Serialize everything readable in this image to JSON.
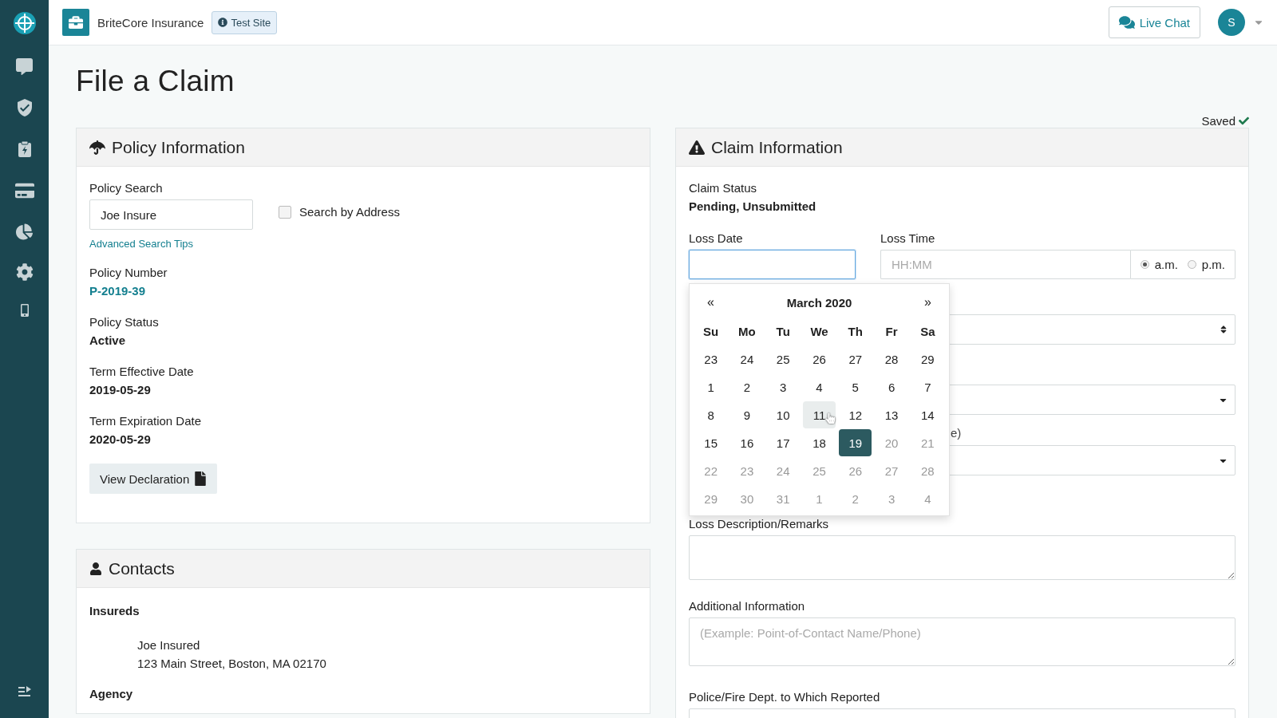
{
  "app": {
    "brand": "BriteCore Insurance",
    "badge": "Test Site",
    "live_chat": "Live Chat",
    "avatar": "S"
  },
  "page": {
    "title": "File a Claim",
    "save_status": "Saved"
  },
  "policy": {
    "title": "Policy Information",
    "search_label": "Policy Search",
    "search_value": "Joe Insure",
    "search_by_address": {
      "label": "Search by Address",
      "checked": false
    },
    "tips_link": "Advanced Search Tips",
    "fields": [
      {
        "label": "Policy Number",
        "value": "P-2019-39",
        "kind": "link"
      },
      {
        "label": "Policy Status",
        "value": "Active",
        "kind": "text"
      },
      {
        "label": "Term Effective Date",
        "value": "2019-05-29",
        "kind": "text"
      },
      {
        "label": "Term Expiration Date",
        "value": "2020-05-29",
        "kind": "text"
      }
    ],
    "button": "View Declaration"
  },
  "contacts": {
    "title": "Contacts",
    "groups": [
      {
        "title": "Insureds",
        "name": "Joe Insured",
        "address": "123 Main Street, Boston, MA 02170"
      }
    ],
    "next_heading": "Agency"
  },
  "claim": {
    "title": "Claim Information",
    "status_label": "Claim Status",
    "status_value": "Pending, Unsubmitted",
    "loss_date": {
      "label": "Loss Date",
      "focused": true
    },
    "loss_time": {
      "label": "Loss Time",
      "placeholder": "HH:MM",
      "meridiem": [
        {
          "label": "a.m.",
          "selected": true
        },
        {
          "label": "p.m.",
          "selected": false
        }
      ]
    },
    "covered_fields": [
      {
        "kind": "spinner"
      },
      {
        "kind": "dropdown"
      },
      {
        "kind": "dropdown",
        "label_tail": "e)"
      }
    ],
    "loss_description": {
      "label": "Loss Description/Remarks"
    },
    "additional": {
      "label": "Additional Information",
      "placeholder": "(Example: Point-of-Contact Name/Phone)"
    },
    "police": {
      "label": "Police/Fire Dept. to Which Reported"
    }
  },
  "calendar": {
    "month": "March 2020",
    "prev": "«",
    "next": "»",
    "weekdays": [
      "Su",
      "Mo",
      "Tu",
      "We",
      "Th",
      "Fr",
      "Sa"
    ],
    "weeks": [
      [
        {
          "label": "23",
          "faded": false,
          "hovered": false,
          "selected": false
        },
        {
          "label": "24",
          "faded": false,
          "hovered": false,
          "selected": false
        },
        {
          "label": "25",
          "faded": false,
          "hovered": false,
          "selected": false
        },
        {
          "label": "26",
          "faded": false,
          "hovered": false,
          "selected": false
        },
        {
          "label": "27",
          "faded": false,
          "hovered": false,
          "selected": false
        },
        {
          "label": "28",
          "faded": false,
          "hovered": false,
          "selected": false
        },
        {
          "label": "29",
          "faded": false,
          "hovered": false,
          "selected": false
        }
      ],
      [
        {
          "label": "1",
          "faded": false,
          "hovered": false,
          "selected": false
        },
        {
          "label": "2",
          "faded": false,
          "hovered": false,
          "selected": false
        },
        {
          "label": "3",
          "faded": false,
          "hovered": false,
          "selected": false
        },
        {
          "label": "4",
          "faded": false,
          "hovered": false,
          "selected": false
        },
        {
          "label": "5",
          "faded": false,
          "hovered": false,
          "selected": false
        },
        {
          "label": "6",
          "faded": false,
          "hovered": false,
          "selected": false
        },
        {
          "label": "7",
          "faded": false,
          "hovered": false,
          "selected": false
        }
      ],
      [
        {
          "label": "8",
          "faded": false,
          "hovered": false,
          "selected": false
        },
        {
          "label": "9",
          "faded": false,
          "hovered": false,
          "selected": false
        },
        {
          "label": "10",
          "faded": false,
          "hovered": false,
          "selected": false
        },
        {
          "label": "11",
          "faded": false,
          "hovered": true,
          "selected": false
        },
        {
          "label": "12",
          "faded": false,
          "hovered": false,
          "selected": false
        },
        {
          "label": "13",
          "faded": false,
          "hovered": false,
          "selected": false
        },
        {
          "label": "14",
          "faded": false,
          "hovered": false,
          "selected": false
        }
      ],
      [
        {
          "label": "15",
          "faded": false,
          "hovered": false,
          "selected": false
        },
        {
          "label": "16",
          "faded": false,
          "hovered": false,
          "selected": false
        },
        {
          "label": "17",
          "faded": false,
          "hovered": false,
          "selected": false
        },
        {
          "label": "18",
          "faded": false,
          "hovered": false,
          "selected": false
        },
        {
          "label": "19",
          "faded": false,
          "hovered": false,
          "selected": true
        },
        {
          "label": "20",
          "faded": true,
          "hovered": false,
          "selected": false
        },
        {
          "label": "21",
          "faded": true,
          "hovered": false,
          "selected": false
        }
      ],
      [
        {
          "label": "22",
          "faded": true,
          "hovered": false,
          "selected": false
        },
        {
          "label": "23",
          "faded": true,
          "hovered": false,
          "selected": false
        },
        {
          "label": "24",
          "faded": true,
          "hovered": false,
          "selected": false
        },
        {
          "label": "25",
          "faded": true,
          "hovered": false,
          "selected": false
        },
        {
          "label": "26",
          "faded": true,
          "hovered": false,
          "selected": false
        },
        {
          "label": "27",
          "faded": true,
          "hovered": false,
          "selected": false
        },
        {
          "label": "28",
          "faded": true,
          "hovered": false,
          "selected": false
        }
      ],
      [
        {
          "label": "29",
          "faded": true,
          "hovered": false,
          "selected": false
        },
        {
          "label": "30",
          "faded": true,
          "hovered": false,
          "selected": false
        },
        {
          "label": "31",
          "faded": true,
          "hovered": false,
          "selected": false
        },
        {
          "label": "1",
          "faded": true,
          "hovered": false,
          "selected": false
        },
        {
          "label": "2",
          "faded": true,
          "hovered": false,
          "selected": false
        },
        {
          "label": "3",
          "faded": true,
          "hovered": false,
          "selected": false
        },
        {
          "label": "4",
          "faded": true,
          "hovered": false,
          "selected": false
        }
      ]
    ]
  }
}
